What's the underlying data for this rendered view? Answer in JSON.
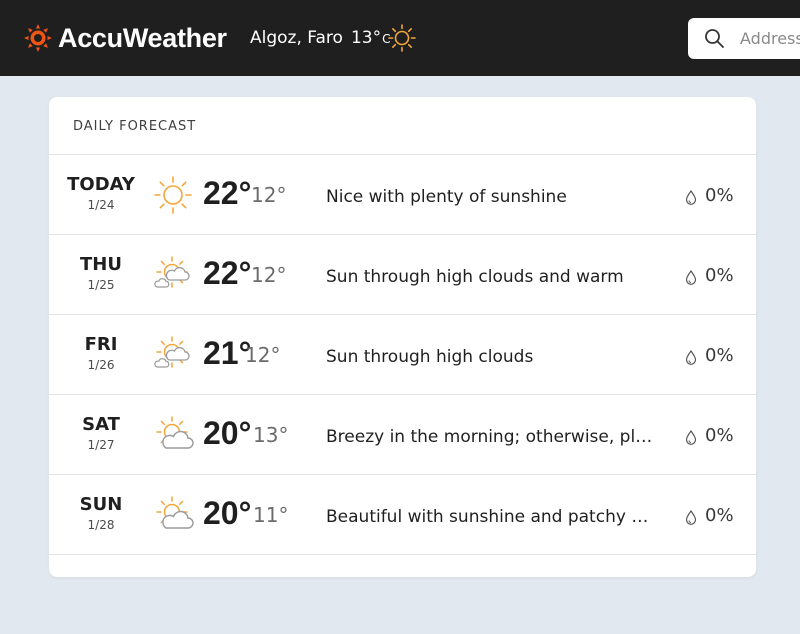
{
  "header": {
    "brand": "AccuWeather",
    "location": "Algoz, Faro",
    "current_temp": "13°",
    "temp_unit": "C",
    "current_icon": "sun-icon",
    "search_placeholder": "Address"
  },
  "forecast": {
    "title": "DAILY FORECAST",
    "days": [
      {
        "day": "TODAY",
        "date": "1/24",
        "icon": "sun-icon",
        "hi": "22°",
        "lo": "12°",
        "phrase": "Nice with plenty of sunshine",
        "precip": "0%"
      },
      {
        "day": "THU",
        "date": "1/25",
        "icon": "sun-high-clouds-icon",
        "hi": "22°",
        "lo": "12°",
        "phrase": "Sun through high clouds and warm",
        "precip": "0%"
      },
      {
        "day": "FRI",
        "date": "1/26",
        "icon": "sun-high-clouds-icon",
        "hi": "21°",
        "lo": "12°",
        "phrase": "Sun through high clouds",
        "precip": "0%"
      },
      {
        "day": "SAT",
        "date": "1/27",
        "icon": "partly-sunny-icon",
        "hi": "20°",
        "lo": "13°",
        "phrase": "Breezy in the morning; otherwise, plea…",
        "precip": "0%"
      },
      {
        "day": "SUN",
        "date": "1/28",
        "icon": "partly-sunny-icon",
        "hi": "20°",
        "lo": "11°",
        "phrase": "Beautiful with sunshine and patchy cl…",
        "precip": "0%"
      }
    ]
  },
  "colors": {
    "header_bg": "#1f1f1f",
    "brand_sun": "#f05514",
    "sun_orange": "#f4a63a",
    "page_bg": "#e2e8ef"
  }
}
